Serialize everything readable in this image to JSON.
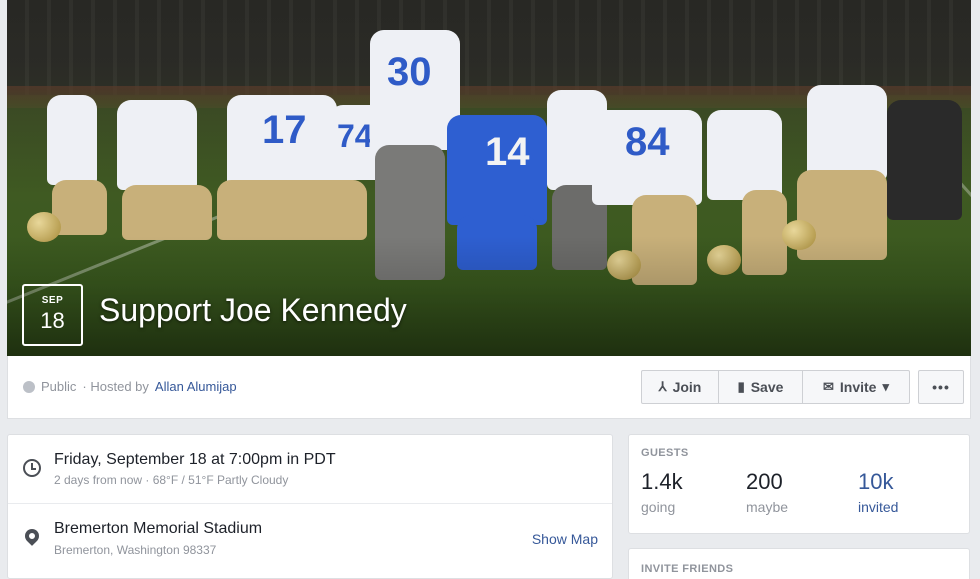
{
  "cover": {
    "date_month": "SEP",
    "date_day": "18",
    "title": "Support Joe Kennedy",
    "jersey_numbers": [
      "30",
      "14",
      "84",
      "17",
      "4",
      "74"
    ]
  },
  "meta": {
    "privacy": "Public",
    "hosted_prefix": "· Hosted by",
    "host_name": "Allan Alumijap"
  },
  "actions": {
    "join_label": "Join",
    "save_label": "Save",
    "invite_label": "Invite",
    "more_label": "•••"
  },
  "details": {
    "datetime": "Friday, September 18 at 7:00pm in PDT",
    "datetime_sub": "2 days from now · 68°F / 51°F Partly Cloudy",
    "location": "Bremerton Memorial Stadium",
    "address": "Bremerton, Washington 98337",
    "show_map": "Show Map"
  },
  "guests": {
    "heading": "GUESTS",
    "going_count": "1.4k",
    "going_label": "going",
    "maybe_count": "200",
    "maybe_label": "maybe",
    "invited_count": "10k",
    "invited_label": "invited"
  },
  "invite_friends": {
    "heading": "INVITE FRIENDS"
  },
  "colors": {
    "link": "#365899",
    "muted": "#90949c",
    "background": "#e9ebee"
  }
}
